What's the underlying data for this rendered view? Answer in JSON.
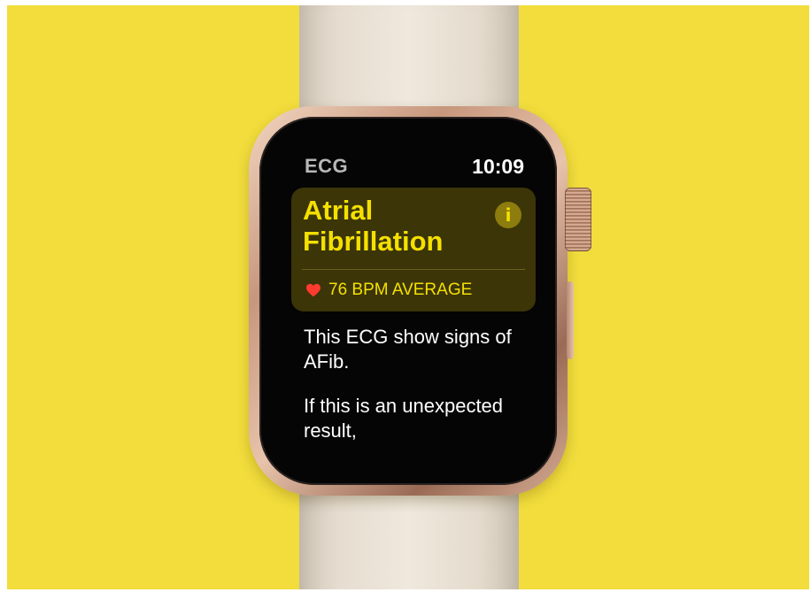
{
  "watch": {
    "colors": {
      "background": "#f2dd3c",
      "card": "#3b3508",
      "accent": "#f5e000",
      "heart": "#ff3b30"
    },
    "status_bar": {
      "app_name": "ECG",
      "time": "10:09"
    },
    "result_card": {
      "title": "Atrial Fibrillation",
      "info_icon": "info-icon",
      "info_glyph": "i",
      "heart_icon": "heart-icon",
      "bpm_label": "76 BPM AVERAGE"
    },
    "body": {
      "paragraph_1": "This ECG show signs of AFib.",
      "paragraph_2": "If this is an unexpected result,"
    }
  }
}
